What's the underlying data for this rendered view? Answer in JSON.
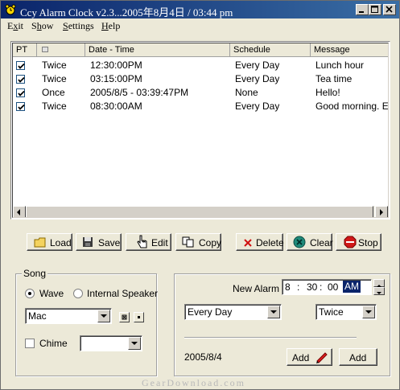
{
  "window": {
    "title": "Ccy Alarm Clock v2.3...2005年8月4日 / 03:44 pm"
  },
  "menu": [
    {
      "label": "Exit",
      "accel": "x"
    },
    {
      "label": "Show",
      "accel": "h"
    },
    {
      "label": "Settings",
      "accel": "S"
    },
    {
      "label": "Help",
      "accel": "H"
    }
  ],
  "list": {
    "columns": [
      "PT",
      "",
      "Date - Time",
      "Schedule",
      "Message"
    ],
    "rows": [
      {
        "checked": true,
        "pt": "Twice",
        "datetime": "12:30:00PM",
        "schedule": "Every Day",
        "message": "Lunch hour"
      },
      {
        "checked": true,
        "pt": "Twice",
        "datetime": "03:15:00PM",
        "schedule": "Every Day",
        "message": "Tea time"
      },
      {
        "checked": true,
        "pt": "Once",
        "datetime": "2005/8/5 - 03:39:47PM",
        "schedule": "None",
        "message": "Hello!"
      },
      {
        "checked": true,
        "pt": "Twice",
        "datetime": "08:30:00AM",
        "schedule": "Every Day",
        "message": "Good morning. Ever"
      }
    ]
  },
  "toolbar": {
    "load": "Load",
    "save": "Save",
    "edit": "Edit",
    "copy": "Copy",
    "delete": "Delete",
    "clear": "Clear",
    "stop": "Stop"
  },
  "song": {
    "title": "Song",
    "wave_label": "Wave",
    "internal_label": "Internal Speaker",
    "selected": "wave",
    "song_value": "Mac",
    "chime_label": "Chime",
    "chime_checked": false,
    "chime_value": ""
  },
  "alarm": {
    "new_alarm_label": "New Alarm :",
    "hour": "8",
    "minute": "30",
    "second": "00",
    "ampm": "AM",
    "schedule_value": "Every Day",
    "pt_value": "Twice",
    "date": "2005/8/4",
    "add_edit_label": "Add",
    "add_label": "Add"
  },
  "watermark": "GearDownload.com",
  "colors": {
    "title_start": "#0a246a",
    "title_end": "#3a6ea5",
    "face": "#ece9d8",
    "selection": "#0a246a"
  }
}
